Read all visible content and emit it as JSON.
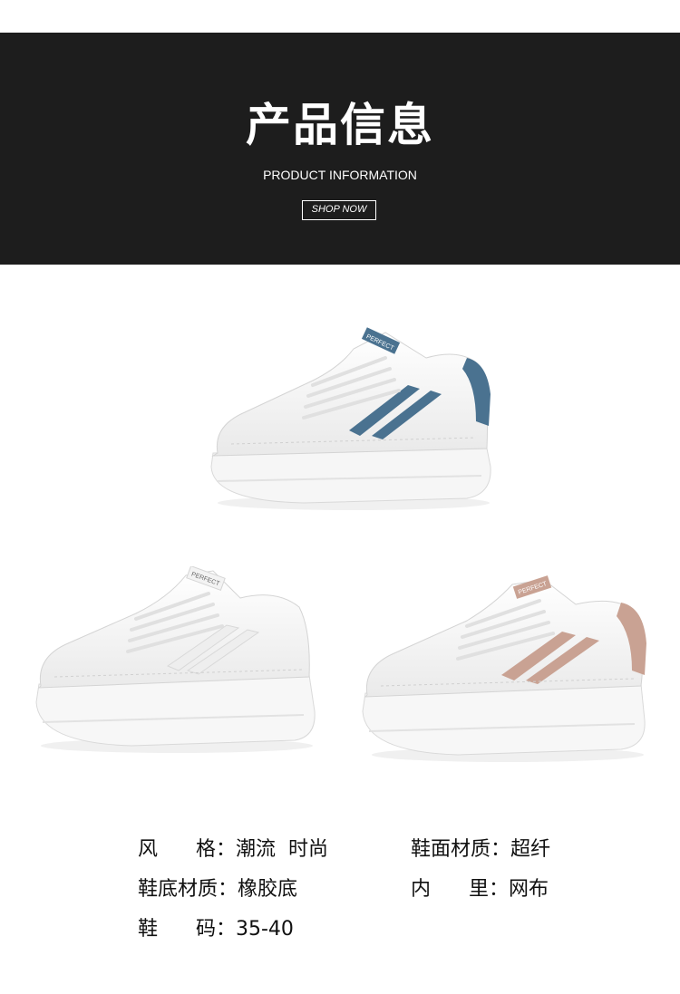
{
  "banner": {
    "title": "产品信息",
    "subtitle": "PRODUCT INFORMATION",
    "button_label": "SHOP NOW"
  },
  "products": [
    {
      "accent_color": "#4a7290",
      "tongue_label": "PERFECT"
    },
    {
      "accent_color": "#eeeeee",
      "tongue_label": "PERFECT"
    },
    {
      "accent_color": "#c9a293",
      "tongue_label": "PERFECT"
    }
  ],
  "specs": {
    "style": "风      格：潮流  时尚",
    "upper_material": "鞋面材质：超纤",
    "sole_material": "鞋底材质：橡胶底",
    "lining": "内      里：网布",
    "size": "鞋      码：35-40"
  }
}
